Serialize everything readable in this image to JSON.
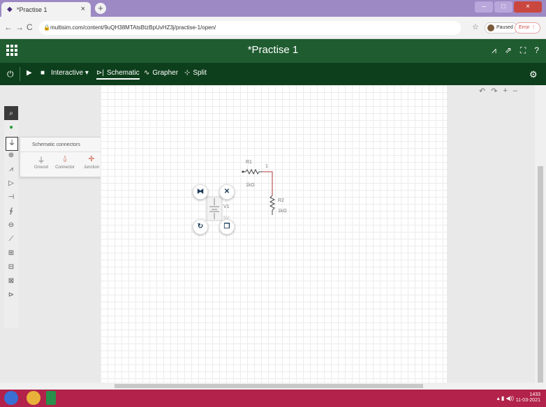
{
  "browser": {
    "tab_title": "*Practise 1",
    "tab_close": "×",
    "new_tab": "+",
    "url": "multisim.com/content/9uQH38MTAtsBtzBpUvHZ3j/practise-1/open/",
    "profile_label": "Paused",
    "error_label": "Error",
    "min": "–",
    "max": "□",
    "close": "×"
  },
  "app": {
    "title": "*Practise 1"
  },
  "toolbar": {
    "power_icon": "power-icon",
    "interactive_label": "Interactive ▾",
    "tabs": [
      {
        "label": "Schematic",
        "active": true
      },
      {
        "label": "Grapher",
        "active": false
      },
      {
        "label": "Split",
        "active": false
      }
    ]
  },
  "palette": {
    "popup_title": "Schematic connectors",
    "popup_items": [
      {
        "label": "Ground",
        "icon": "ground-icon"
      },
      {
        "label": "Connector",
        "icon": "connector-icon"
      },
      {
        "label": "Junction",
        "icon": "junction-icon"
      }
    ]
  },
  "schematic": {
    "r1_name": "R1",
    "r1_value": "1kΩ",
    "r2_name": "R2",
    "r2_value": "1kΩ",
    "net_label": "1",
    "v1_name": "V1",
    "v1_value": "5V"
  },
  "taskbar": {
    "time": "1433",
    "date": "11-03-2021"
  },
  "colors": {
    "app_header": "#1f5c30",
    "toolbar": "#0e3f1c",
    "wire": "#b23a3a",
    "taskbar": "#b2224a"
  }
}
